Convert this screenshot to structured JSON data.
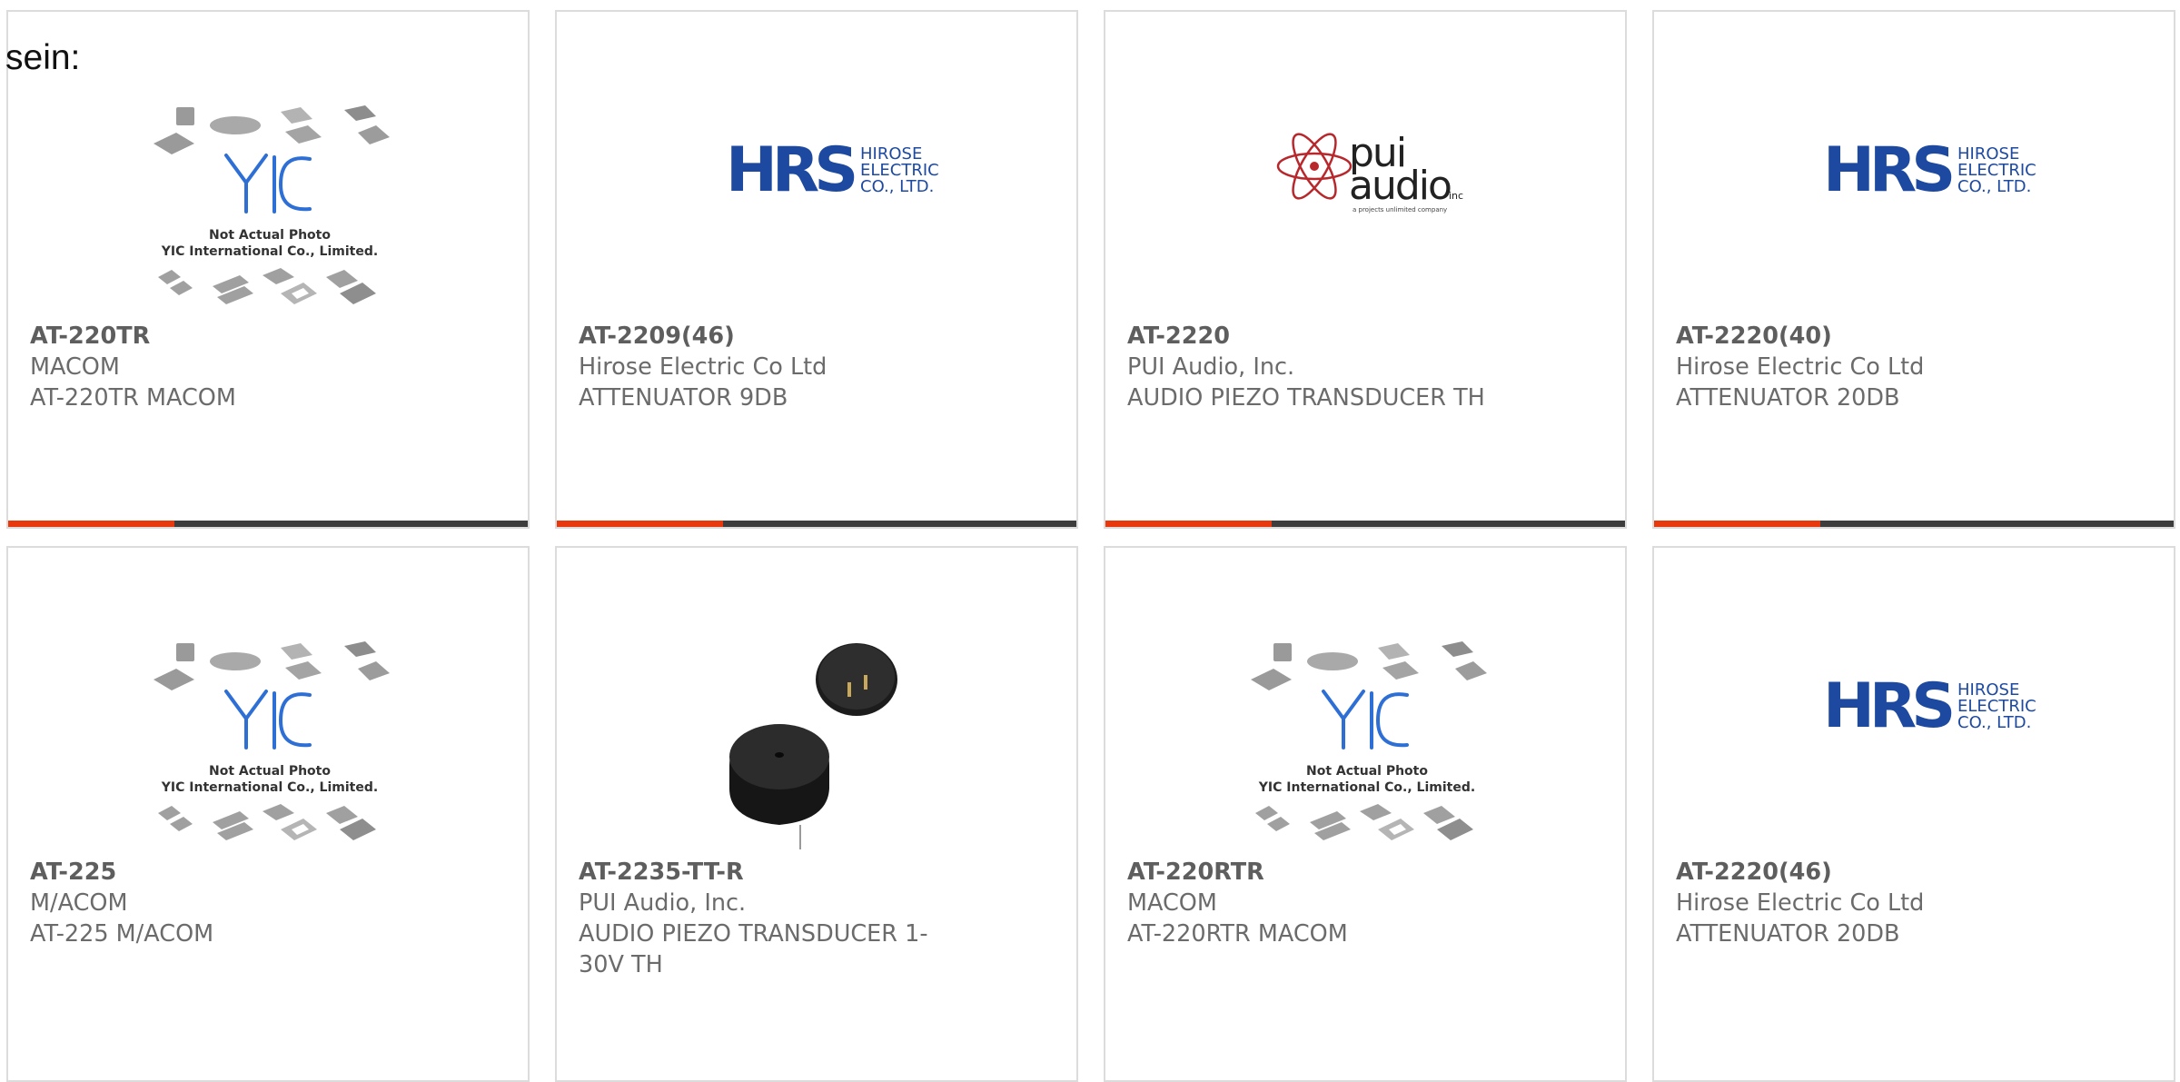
{
  "intro_text": "sein:",
  "colors": {
    "accent": "#e8390e",
    "bar_dark": "#3d3d3d",
    "hrs_blue": "#1d4aa0",
    "yic_blue": "#2e6fd6",
    "pui_red": "#b8272b"
  },
  "yic_logo": {
    "mark": "YIC",
    "caption_1": "Not Actual Photo",
    "caption_2": "YIC International Co., Limited."
  },
  "hrs_logo": {
    "mark": "HRS",
    "line_1": "HIROSE",
    "line_2": "ELECTRIC",
    "line_3": "CO., LTD."
  },
  "pui_logo": {
    "line_1": "pui",
    "line_2": "audio",
    "suffix": "inc",
    "tagline": "a projects unlimited company"
  },
  "products": [
    {
      "part": "AT-220TR",
      "maker": "MACOM",
      "desc": "AT-220TR MACOM",
      "image": "yic-placeholder"
    },
    {
      "part": "AT-2209(46)",
      "maker": "Hirose Electric Co Ltd",
      "desc": "ATTENUATOR 9DB",
      "image": "hrs-logo"
    },
    {
      "part": "AT-2220",
      "maker": "PUI Audio, Inc.",
      "desc": "AUDIO PIEZO TRANSDUCER TH",
      "image": "pui-logo"
    },
    {
      "part": "AT-2220(40)",
      "maker": "Hirose Electric Co Ltd",
      "desc": "ATTENUATOR 20DB",
      "image": "hrs-logo"
    },
    {
      "part": "AT-225",
      "maker": "M/ACOM",
      "desc": "AT-225 M/ACOM",
      "image": "yic-placeholder"
    },
    {
      "part": "AT-2235-TT-R",
      "maker": "PUI Audio, Inc.",
      "desc": "AUDIO PIEZO TRANSDUCER 1-30V TH",
      "image": "piezo-photo"
    },
    {
      "part": "AT-220RTR",
      "maker": "MACOM",
      "desc": "AT-220RTR MACOM",
      "image": "yic-placeholder"
    },
    {
      "part": "AT-2220(46)",
      "maker": "Hirose Electric Co Ltd",
      "desc": "ATTENUATOR 20DB",
      "image": "hrs-logo"
    }
  ]
}
